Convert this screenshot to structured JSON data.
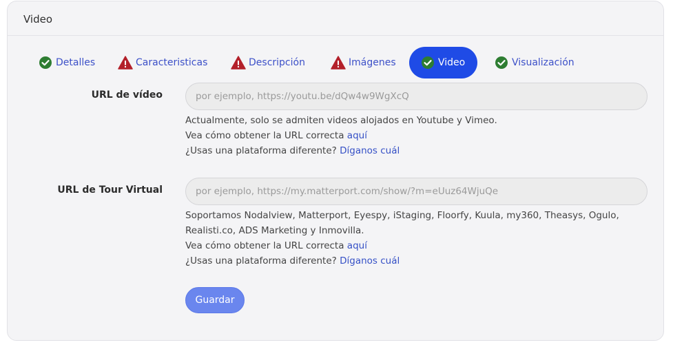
{
  "card": {
    "title": "Video"
  },
  "tabs": [
    {
      "label": "Detalles",
      "status": "ok"
    },
    {
      "label": "Caracteristicas",
      "status": "warn"
    },
    {
      "label": "Descripción",
      "status": "warn"
    },
    {
      "label": "Imágenes",
      "status": "warn"
    },
    {
      "label": "Video",
      "status": "ok",
      "active": true
    },
    {
      "label": "Visualización",
      "status": "ok"
    }
  ],
  "video": {
    "label": "URL de vídeo",
    "value": "",
    "placeholder": "por ejemplo, https://youtu.be/dQw4w9WgXcQ",
    "help_line1": "Actualmente, solo se admiten videos alojados en Youtube y Vimeo.",
    "help_line2_text": "Vea cómo obtener la URL correcta ",
    "help_line2_link": "aquí",
    "help_line3_text": "¿Usas una plataforma diferente? ",
    "help_line3_link": "Díganos cuál"
  },
  "tour": {
    "label": "URL de Tour Virtual",
    "value": "",
    "placeholder": "por ejemplo, https://my.matterport.com/show/?m=eUuz64WjuQe",
    "help_line1": "Soportamos Nodalview, Matterport, Eyespy, iStaging, Floorfy, Kuula, my360, Theasys, Ogulo,",
    "help_line1b": "Realisti.co, ADS Marketing y Inmovilla.",
    "help_line2_text": "Vea cómo obtener la URL correcta ",
    "help_line2_link": "aquí",
    "help_line3_text": "¿Usas una plataforma diferente? ",
    "help_line3_link": "Díganos cuál"
  },
  "save_label": "Guardar",
  "colors": {
    "ok": "#2e7d32",
    "warn": "#b3202a",
    "accent": "#1f4be6"
  }
}
